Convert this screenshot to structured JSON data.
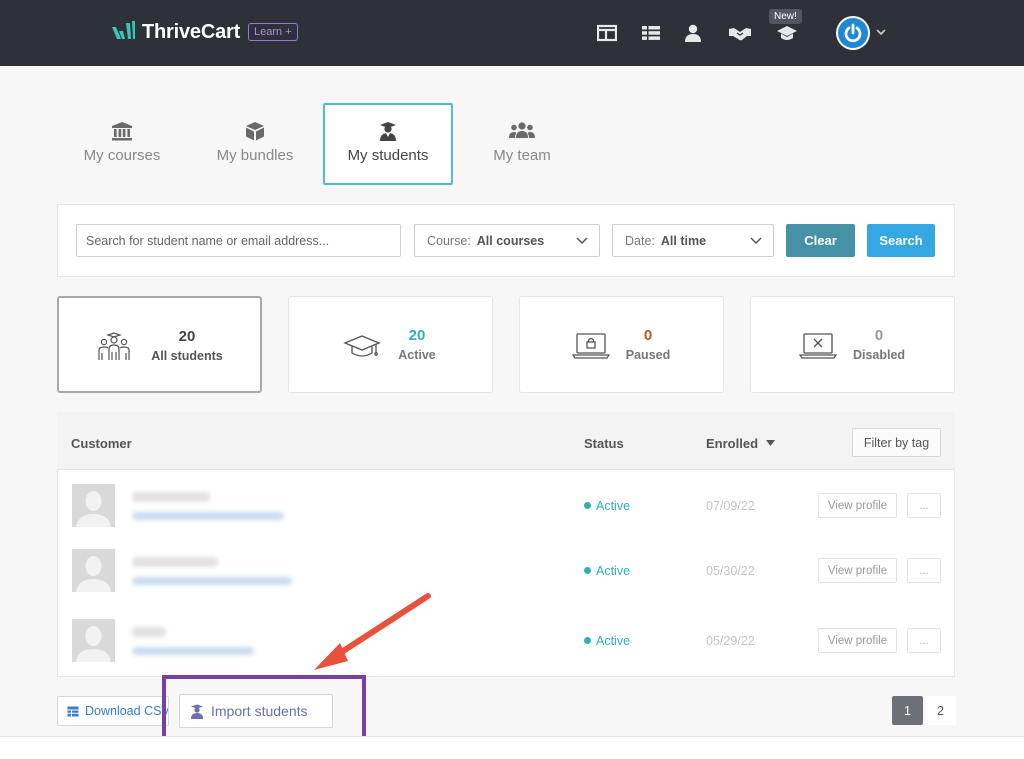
{
  "header": {
    "brand": "ThriveCart",
    "badge": "Learn +",
    "new_tag": "New!",
    "icons": [
      "layout-icon",
      "list-icon",
      "user-icon",
      "handshake-icon",
      "graduation-cap-icon"
    ],
    "avatar": "power-icon"
  },
  "tabs": [
    {
      "label": "My courses",
      "icon": "bank-icon"
    },
    {
      "label": "My bundles",
      "icon": "box-icon"
    },
    {
      "label": "My students",
      "icon": "student-icon",
      "active": true
    },
    {
      "label": "My team",
      "icon": "team-icon"
    }
  ],
  "filters": {
    "search_placeholder": "Search for student name or email address...",
    "course_label": "Course:",
    "course_value": "All courses",
    "date_label": "Date:",
    "date_value": "All time",
    "clear_label": "Clear",
    "search_label": "Search"
  },
  "stats": [
    {
      "value": "20",
      "label": "All students",
      "color": "#444444"
    },
    {
      "value": "20",
      "label": "Active",
      "color": "#2fb1b0"
    },
    {
      "value": "0",
      "label": "Paused",
      "color": "#b5592b"
    },
    {
      "value": "0",
      "label": "Disabled",
      "color": "#999999"
    }
  ],
  "table": {
    "col_customer": "Customer",
    "col_status": "Status",
    "col_enrolled": "Enrolled",
    "filter_by_tag": "Filter by tag",
    "rows": [
      {
        "status": "Active",
        "enrolled": "07/09/22",
        "view": "View profile",
        "more": "..."
      },
      {
        "status": "Active",
        "enrolled": "05/30/22",
        "view": "View profile",
        "more": "..."
      },
      {
        "status": "Active",
        "enrolled": "05/29/22",
        "view": "View profile",
        "more": "..."
      }
    ]
  },
  "footer": {
    "download_label": "Download CSV",
    "import_label": "Import students",
    "pages": [
      "1",
      "2"
    ]
  },
  "colors": {
    "accent_teal": "#4fc1bf",
    "annotation_purple": "#7a3fa3",
    "annotation_arrow": "#e8523d"
  }
}
